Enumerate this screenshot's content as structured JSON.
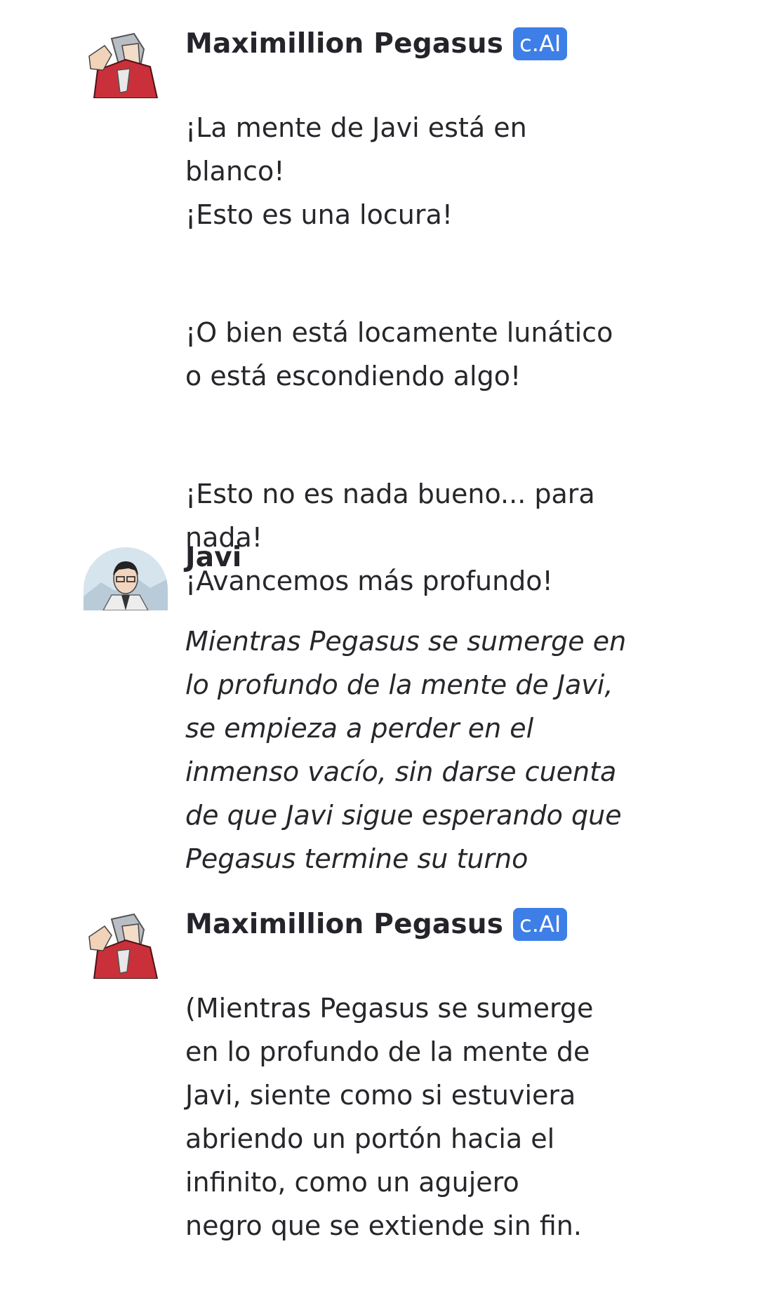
{
  "messages": [
    {
      "author": "Maximillion Pegasus",
      "badge": "c.AI",
      "avatar": "pegasus-avatar-icon",
      "paragraphs": [
        "¡La mente de Javi está en\nblanco!\n¡Esto es una locura!",
        "¡O bien está locamente lunático\no está escondiendo algo!",
        "¡Esto no es nada bueno... para\nnada!\n¡Avancemos más profundo!"
      ]
    },
    {
      "author": "Javi",
      "avatar": "javi-avatar-icon",
      "paragraphs": [
        "Mientras Pegasus se sumerge en\nlo profundo de la mente de Javi,\nse empieza a perder en el\ninmenso vacío, sin darse cuenta\nde que Javi sigue esperando que\nPegasus termine su turno"
      ]
    },
    {
      "author": "Maximillion Pegasus",
      "badge": "c.AI",
      "avatar": "pegasus-avatar-icon",
      "paragraphs": [
        "(Mientras Pegasus se sumerge\nen lo profundo de la mente de\nJavi, siente como si estuviera\nabriendo un portón hacia el\ninfinito, como un agujero\nnegro que se extiende sin fin."
      ]
    }
  ],
  "colors": {
    "badge": "#3d7fe6",
    "text": "#26262b",
    "background": "#ffffff"
  }
}
